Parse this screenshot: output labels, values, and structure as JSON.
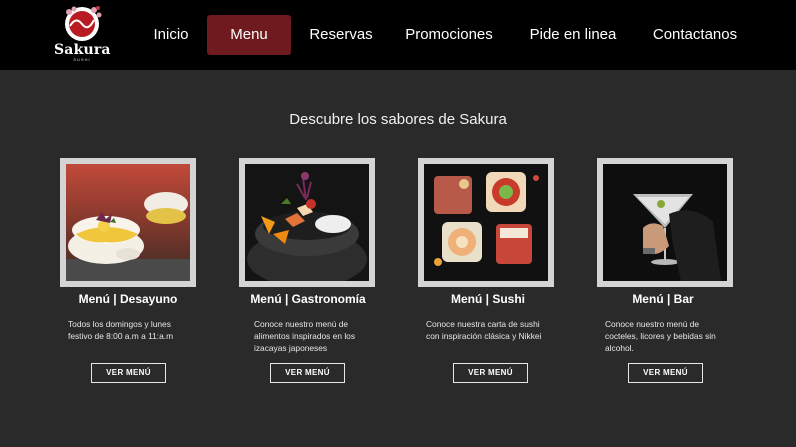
{
  "brand": {
    "name": "Sakura",
    "tagline": "SUSHI"
  },
  "nav": {
    "items": [
      {
        "label": "Inicio",
        "active": false
      },
      {
        "label": "Menu",
        "active": true
      },
      {
        "label": "Reservas",
        "active": false
      },
      {
        "label": "Promociones",
        "active": false
      },
      {
        "label": "Pide en linea",
        "active": false
      },
      {
        "label": "Contactanos",
        "active": false
      }
    ]
  },
  "main": {
    "subtitle": "Descubre los sabores de Sakura",
    "cards": [
      {
        "title": "Menú | Desayuno",
        "desc_lines": [
          "Todos los domingos y lunes",
          "festivo de 8:00 a.m a 11:a.m"
        ],
        "button": "VER MENÚ",
        "image": "breakfast-photo"
      },
      {
        "title": "Menú | Gastronomía",
        "desc_lines": [
          "Conoce nuestro menú de",
          "alimentos inspirados en los",
          "izacayas japoneses"
        ],
        "button": "VER MENÚ",
        "image": "gastronomy-photo"
      },
      {
        "title": "Menú | Sushi",
        "desc_lines": [
          "Conoce nuestra carta de sushi",
          "con inspiración clásica y Nikkei"
        ],
        "button": "VER MENÚ",
        "image": "sushi-photo"
      },
      {
        "title": "Menú | Bar",
        "desc_lines": [
          "Conoce nuestro menú de",
          "cocteles, licores y bebidas sin",
          "alcohol."
        ],
        "button": "VER MENÚ",
        "image": "cocktail-photo"
      }
    ]
  },
  "colors": {
    "background": "#2b2a2b",
    "navbar": "#000000",
    "accent": "#6e1a1e",
    "frame": "#d4d4d4"
  }
}
